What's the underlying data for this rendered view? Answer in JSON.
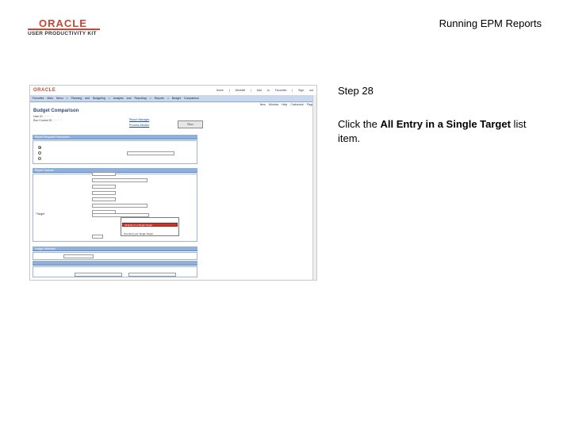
{
  "doc": {
    "logo_word": "ORACLE",
    "logo_sub": "USER PRODUCTIVITY KIT",
    "title": "Running EPM Reports",
    "step_title": "Step 28",
    "instruction_prefix": "Click the ",
    "instruction_bold": "All Entry in a Single Target",
    "instruction_suffix": " list item."
  },
  "screen": {
    "logo": "ORACLE",
    "header_links": "Home | Worklist | Add to Favorites | Sign out",
    "nav": "Favorites  Main Menu > Planning and Budgeting > Analysis and Reporting > Reports > Budget Comparison",
    "toolbar": "New Window  Help  Customize Page",
    "page_title": "Budget Comparison",
    "run_button": "Run",
    "report_manager_link": "Report Manager",
    "process_monitor_link": "Process Monitor",
    "report_request_label": "Report Request Parameters",
    "target_label": "*Target",
    "options_label": "Report Options",
    "ledger_label": "Ledger Selection",
    "dropdown_options": [
      "All Entry in a Single Target",
      "",
      "One Entry per Single Target"
    ],
    "selected_option": "All Entry in a Single Target"
  },
  "colors": {
    "oracle_red": "#c74634",
    "band_blue": "#8fb0dd",
    "highlight": "#c0392b"
  }
}
